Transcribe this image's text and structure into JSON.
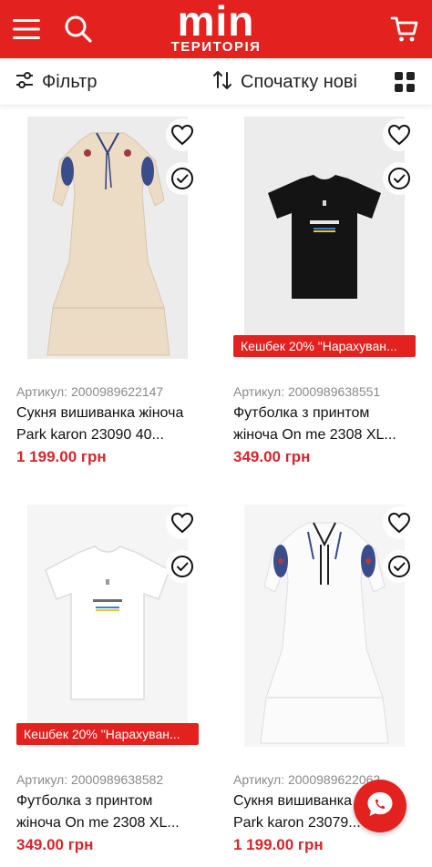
{
  "header": {
    "logo_main": "min",
    "logo_sub": "ТЕРИТОРІЯ",
    "icons": [
      "hamburger-menu-icon",
      "search-icon",
      "cart-icon"
    ],
    "brand_color": "#e3221f"
  },
  "toolbar": {
    "filter_label": "Фільтр",
    "sort_label": "Спочатку нові",
    "icons": [
      "filter-sliders-icon",
      "sort-arrows-icon",
      "grid-view-icon"
    ]
  },
  "products": [
    {
      "sku": "Артикул: 2000989622147",
      "title": "Сукня вишиванка жіноча Park karon 23090 40...",
      "price": "1 199.00 грн",
      "cashback": ""
    },
    {
      "sku": "Артикул: 2000989638551",
      "title": "Футболка з принтом жіноча On me 2308 XL...",
      "price": "349.00 грн",
      "cashback": "Кешбек 20% \"Нарахуван..."
    },
    {
      "sku": "Артикул: 2000989638582",
      "title": "Футболка з принтом жіноча On me 2308 XL...",
      "price": "349.00 грн",
      "cashback": "Кешбек 20% \"Нарахуван..."
    },
    {
      "sku": "Артикул: 2000989622062",
      "title": "Сукня вишиванка жіноча Park karon 23079...",
      "price": "1 199.00 грн",
      "cashback": ""
    }
  ],
  "chat": {
    "icon": "chat-bubble-icon"
  }
}
